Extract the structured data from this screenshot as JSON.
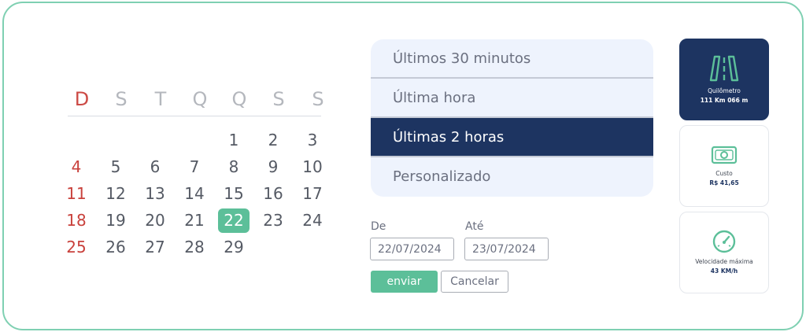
{
  "calendar": {
    "weekdays": [
      "D",
      "S",
      "T",
      "Q",
      "Q",
      "S",
      "S"
    ],
    "weeks": [
      [
        "",
        "",
        "",
        "",
        "1",
        "2",
        "3"
      ],
      [
        "4",
        "5",
        "6",
        "7",
        "8",
        "9",
        "10"
      ],
      [
        "11",
        "12",
        "13",
        "14",
        "15",
        "16",
        "17"
      ],
      [
        "18",
        "19",
        "20",
        "21",
        "22",
        "23",
        "24"
      ],
      [
        "25",
        "26",
        "27",
        "28",
        "29",
        "",
        ""
      ]
    ],
    "selected_day": "22"
  },
  "periods": [
    {
      "label": "Últimos 30 minutos",
      "active": false
    },
    {
      "label": "Última hora",
      "active": false
    },
    {
      "label": "Últimas 2 horas",
      "active": true
    },
    {
      "label": "Personalizado",
      "active": false
    }
  ],
  "range": {
    "from_label": "De",
    "from_value": "22/07/2024",
    "to_label": "Até",
    "to_value": "23/07/2024"
  },
  "actions": {
    "send_label": "enviar",
    "cancel_label": "Cancelar"
  },
  "stats": {
    "distance": {
      "icon": "road-icon",
      "title": "Quilômetro",
      "value": "111 Km 066 m"
    },
    "cost": {
      "icon": "banknote-icon",
      "title": "Custo",
      "value": "R$ 41,65"
    },
    "speed": {
      "icon": "speedometer-icon",
      "title": "Velocidade máxima",
      "value": "43 KM/h"
    }
  },
  "colors": {
    "accent": "#5cbf99",
    "navy": "#1d3461",
    "sunday": "#c9413c"
  }
}
